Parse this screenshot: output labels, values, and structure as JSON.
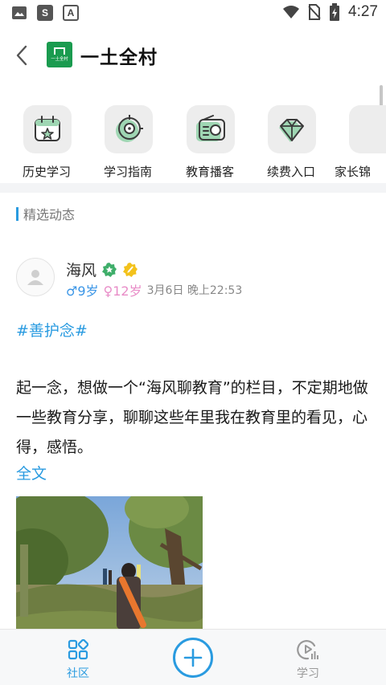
{
  "status_bar": {
    "time": "4:27",
    "left_icons": [
      "gallery-icon",
      "s-app-icon",
      "a-app-icon"
    ],
    "s_label": "S",
    "a_label": "A"
  },
  "header": {
    "title": "一土全村",
    "logo_text": "一土全村"
  },
  "quick_nav": {
    "items": [
      {
        "label": "历史学习",
        "icon": "calendar-star-icon"
      },
      {
        "label": "学习指南",
        "icon": "target-icon"
      },
      {
        "label": "教育播客",
        "icon": "radio-icon"
      },
      {
        "label": "续费入口",
        "icon": "diamond-icon"
      },
      {
        "label": "家长锦",
        "icon": "parent-tips-icon"
      }
    ]
  },
  "section": {
    "title": "精选动态"
  },
  "post": {
    "author": "海风",
    "child1": "♂9岁",
    "child2": "♀12岁",
    "date": "3月6日 晚上22:53",
    "hashtag": "#善护念#",
    "body": "起一念，想做一个“海风聊教育”的栏目，不定期地做一些教育分享，聊聊这些年里我在教育里的看见，心得，感悟。",
    "read_more": "全文"
  },
  "bottom_nav": {
    "community_label": "社区",
    "learn_label": "学习"
  },
  "colors": {
    "accent": "#2a9be0",
    "brand_green": "#1a9b4f",
    "badge_green": "#3fae6a",
    "badge_yellow": "#f3c21c"
  }
}
